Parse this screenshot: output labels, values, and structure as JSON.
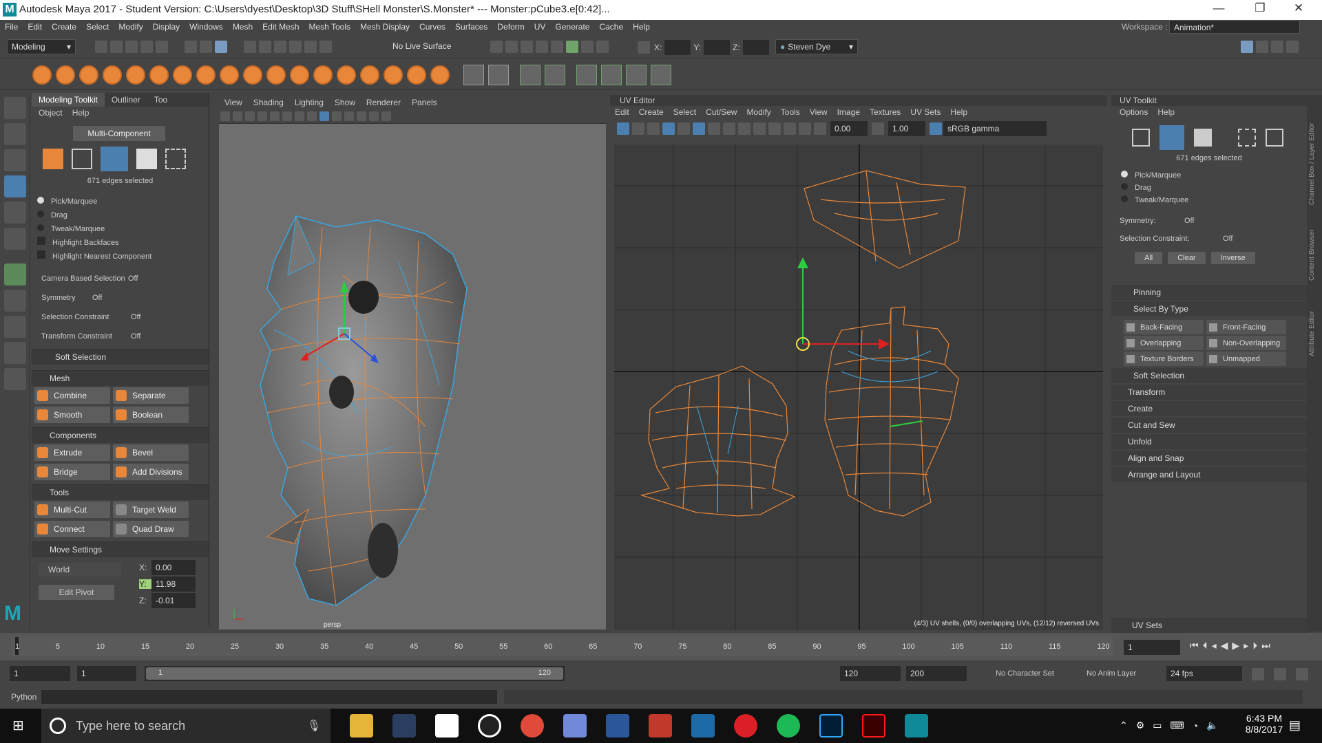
{
  "title_bar": {
    "title": "Autodesk Maya 2017 - Student Version: C:\\Users\\dyest\\Desktop\\3D Stuff\\SHell Monster\\S.Monster*  ---  Monster:pCube3.e[0:42]...",
    "minimize": "—",
    "restore": "❐",
    "close": "✕"
  },
  "menu": [
    "File",
    "Edit",
    "Create",
    "Select",
    "Modify",
    "Display",
    "Windows",
    "Mesh",
    "Edit Mesh",
    "Mesh Tools",
    "Mesh Display",
    "Curves",
    "Surfaces",
    "Deform",
    "UV",
    "Generate",
    "Cache",
    "Help"
  ],
  "workspace": {
    "label": "Workspace :",
    "value": "Animation*"
  },
  "toolbar": {
    "mode": "Modeling",
    "live_surface": "No Live Surface",
    "x_label": "X:",
    "y_label": "Y:",
    "z_label": "Z:",
    "user": "Steven Dye"
  },
  "toolkit": {
    "tabs": [
      "Modeling Toolkit",
      "Outliner",
      "Too"
    ],
    "menu": [
      "Object",
      "Help"
    ],
    "multi_component": "Multi-Component",
    "selected": "671 edges selected",
    "pick_options": [
      "Pick/Marquee",
      "Drag",
      "Tweak/Marquee"
    ],
    "checks": [
      "Highlight Backfaces",
      "Highlight Nearest Component"
    ],
    "rows": [
      {
        "label": "Camera Based Selection",
        "value": "Off"
      },
      {
        "label": "Symmetry",
        "value": "Off"
      },
      {
        "label": "Selection Constraint",
        "value": "Off"
      },
      {
        "label": "Transform Constraint",
        "value": "Off"
      }
    ],
    "soft_selection": "Soft Selection",
    "mesh_header": "Mesh",
    "mesh_buttons": [
      "Combine",
      "Separate",
      "Smooth",
      "Boolean"
    ],
    "components_header": "Components",
    "components_buttons": [
      "Extrude",
      "Bevel",
      "Bridge",
      "Add Divisions"
    ],
    "tools_header": "Tools",
    "tools_buttons": [
      "Multi-Cut",
      "Target Weld",
      "Connect",
      "Quad Draw"
    ],
    "move_header": "Move Settings",
    "world": "World",
    "edit_pivot": "Edit Pivot",
    "x_label": "X:",
    "y_label": "Y:",
    "z_label": "Z:",
    "x": "0.00",
    "y": "11.98",
    "z": "-0.01"
  },
  "viewport": {
    "menu": [
      "View",
      "Shading",
      "Lighting",
      "Show",
      "Renderer",
      "Panels"
    ],
    "camera_label": "persp"
  },
  "uv_editor": {
    "title": "UV Editor",
    "menu": [
      "Edit",
      "Create",
      "Select",
      "Cut/Sew",
      "Modify",
      "Tools",
      "View",
      "Image",
      "Textures",
      "UV Sets",
      "Help"
    ],
    "value1": "0.00",
    "value2": "1.00",
    "gamma": "sRGB gamma",
    "status": "(4/3) UV shells, (0/0) overlapping UVs, (12/12) reversed UVs"
  },
  "uv_toolkit": {
    "title": "UV Toolkit",
    "menu": [
      "Options",
      "Help"
    ],
    "selected": "671 edges selected",
    "pick_options": [
      "Pick/Marquee",
      "Drag",
      "Tweak/Marquee"
    ],
    "symmetry": {
      "label": "Symmetry:",
      "value": "Off"
    },
    "constraint": {
      "label": "Selection Constraint:",
      "value": "Off"
    },
    "buttons": [
      "All",
      "Clear",
      "Inverse"
    ],
    "pinning": "Pinning",
    "select_by_type": "Select By Type",
    "type_buttons": [
      "Back-Facing",
      "Front-Facing",
      "Overlapping",
      "Non-Overlapping",
      "Texture Borders",
      "Unmapped"
    ],
    "sections": [
      "Soft Selection",
      "Transform",
      "Create",
      "Cut and Sew",
      "Unfold",
      "Align and Snap",
      "Arrange and Layout"
    ],
    "uv_sets": "UV Sets"
  },
  "side_strip": [
    "Channel Box / Layer Editor",
    "Content Browser",
    "Attribute Editor"
  ],
  "timeline": {
    "ticks": [
      "1",
      "5",
      "10",
      "15",
      "20",
      "25",
      "30",
      "35",
      "40",
      "45",
      "50",
      "55",
      "60",
      "65",
      "70",
      "75",
      "80",
      "85",
      "90",
      "95",
      "100",
      "105",
      "110",
      "115",
      "120"
    ],
    "current": "1"
  },
  "range": {
    "start": "1",
    "start2": "1",
    "inner_start": "1",
    "inner_end": "120",
    "end": "120",
    "end2": "200",
    "char_set": "No Character Set",
    "anim_layer": "No Anim Layer",
    "fps": "24 fps"
  },
  "cmd": {
    "lang": "Python"
  },
  "taskbar": {
    "search": "Type here to search",
    "time": "6:43 PM",
    "date": "8/8/2017"
  },
  "colors": {
    "orange": "#e8873a",
    "blue_edge": "#3aa6e0",
    "accent": "#4a7fb0"
  }
}
